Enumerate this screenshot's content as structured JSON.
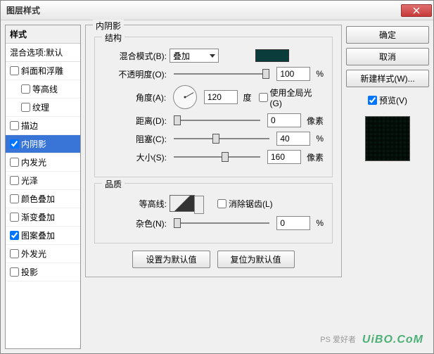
{
  "title": "图层样式",
  "left": {
    "header": "样式",
    "sub": "混合选项:默认",
    "items": [
      {
        "label": "斜面和浮雕",
        "checked": false,
        "indent": false
      },
      {
        "label": "等高线",
        "checked": false,
        "indent": true
      },
      {
        "label": "纹理",
        "checked": false,
        "indent": true
      },
      {
        "label": "描边",
        "checked": false,
        "indent": false
      },
      {
        "label": "内阴影",
        "checked": true,
        "indent": false,
        "active": true
      },
      {
        "label": "内发光",
        "checked": false,
        "indent": false
      },
      {
        "label": "光泽",
        "checked": false,
        "indent": false
      },
      {
        "label": "颜色叠加",
        "checked": false,
        "indent": false
      },
      {
        "label": "渐变叠加",
        "checked": false,
        "indent": false
      },
      {
        "label": "图案叠加",
        "checked": true,
        "indent": false
      },
      {
        "label": "外发光",
        "checked": false,
        "indent": false
      },
      {
        "label": "投影",
        "checked": false,
        "indent": false
      }
    ]
  },
  "center": {
    "group_title": "内阴影",
    "structure": {
      "title": "结构",
      "blend_label": "混合模式(B):",
      "blend_value": "叠加",
      "swatch_color": "#0a3c3c",
      "opacity_label": "不透明度(O):",
      "opacity_value": "100",
      "opacity_unit": "%",
      "angle_label": "角度(A):",
      "angle_value": "120",
      "angle_unit": "度",
      "global_light_label": "使用全局光(G)",
      "global_light_checked": false,
      "distance_label": "距离(D):",
      "distance_value": "0",
      "distance_unit": "像素",
      "choke_label": "阻塞(C):",
      "choke_value": "40",
      "choke_unit": "%",
      "size_label": "大小(S):",
      "size_value": "160",
      "size_unit": "像素"
    },
    "quality": {
      "title": "品质",
      "contour_label": "等高线:",
      "antialias_label": "消除锯齿(L)",
      "antialias_checked": false,
      "noise_label": "杂色(N):",
      "noise_value": "0",
      "noise_unit": "%"
    },
    "buttons": {
      "make_default": "设置为默认值",
      "reset_default": "复位为默认值"
    }
  },
  "right": {
    "ok": "确定",
    "cancel": "取消",
    "new_style": "新建样式(W)...",
    "preview_label": "预览(V)",
    "preview_checked": true
  },
  "watermark": "UiBO.CoM",
  "watermark2": "PS 爱好者"
}
